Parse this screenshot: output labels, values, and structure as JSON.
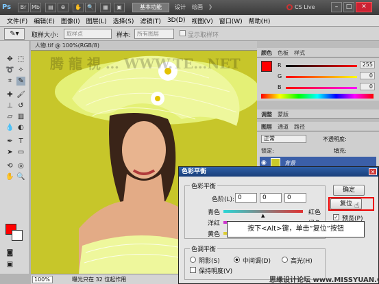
{
  "titlebar": {
    "logo": "Ps",
    "workspace": "基本功能",
    "workspace_links": [
      "设计",
      "绘画",
      "》"
    ],
    "cs_live": "CS Live",
    "minimize": "–",
    "maximize": "□",
    "close": "✕"
  },
  "menu": [
    "文件(F)",
    "编辑(E)",
    "图像(I)",
    "图层(L)",
    "选择(S)",
    "滤镜(T)",
    "3D(D)",
    "视图(V)",
    "窗口(W)",
    "帮助(H)"
  ],
  "options": {
    "sample_size_label": "取样大小:",
    "sample_size_value": "取样点",
    "sample_label": "样本:",
    "sample_value": "所有图层",
    "show_ring": "显示取样环"
  },
  "document": {
    "tab": "人物.tif @ 100%(RGB/8)",
    "watermark": "腾 龍 視 …  WWW.TE…NET",
    "zoom": "100%",
    "status": "曝光只在 32 位起作用"
  },
  "panels": {
    "color_tabs": [
      "颜色",
      "色板",
      "样式"
    ],
    "sliders": [
      {
        "label": "R",
        "value": "255"
      },
      {
        "label": "G",
        "value": "0"
      },
      {
        "label": "B",
        "value": "0"
      }
    ],
    "adjust_tabs": [
      "调整",
      "蒙版"
    ],
    "layer_tabs": [
      "图层",
      "通道",
      "路径"
    ],
    "blend_mode": "正常",
    "opacity_label": "不透明度:",
    "lock_label": "锁定:",
    "fill_label": "填充:",
    "layer_name": "背景"
  },
  "dialog": {
    "title": "色彩平衡",
    "close": "✕",
    "balance_group": "色彩平衡",
    "levels_label": "色阶(L):",
    "levels": [
      "0",
      "0",
      "0"
    ],
    "rows": [
      {
        "left": "青色",
        "right": "红色"
      },
      {
        "left": "洋红",
        "right": "绿色"
      },
      {
        "left": "黄色",
        "right": "蓝色"
      }
    ],
    "tone_group": "色调平衡",
    "tones": [
      "阴影(S)",
      "中间调(D)",
      "高光(H)"
    ],
    "selected_tone": "中间调(D)",
    "preserve": "保持明度(V)",
    "ok": "确定",
    "reset": "复位",
    "preview": "预览(P)",
    "callout": "按下<Alt>键，单击“复位”按钮"
  },
  "footer": "思缘设计论坛 www.MISSYUAN.COM"
}
